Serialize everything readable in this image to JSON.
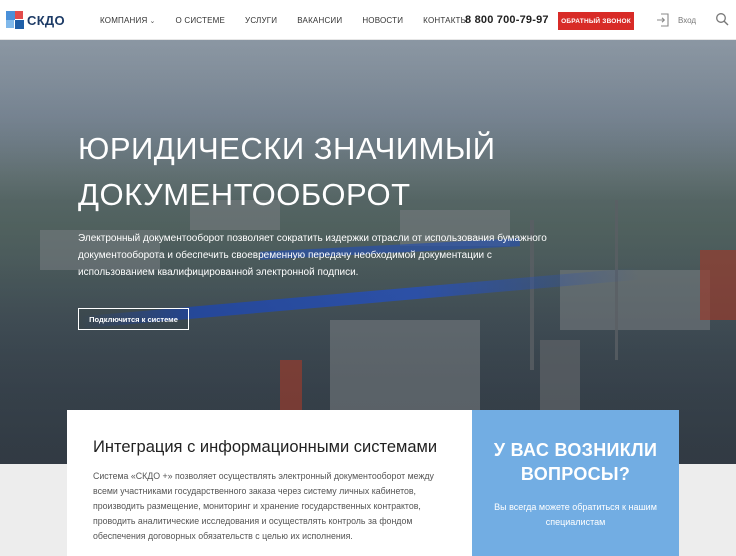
{
  "brand": {
    "name": "СКДО",
    "colors": {
      "blue": "#4a90d9",
      "red": "#e24b4b",
      "dark": "#1d3b66"
    }
  },
  "nav": {
    "items": [
      {
        "label": "КОМПАНИЯ",
        "has_dropdown": true
      },
      {
        "label": "О СИСТЕМЕ"
      },
      {
        "label": "УСЛУГИ"
      },
      {
        "label": "ВАКАНСИИ"
      },
      {
        "label": "НОВОСТИ"
      },
      {
        "label": "КОНТАКТЫ"
      }
    ]
  },
  "header": {
    "phone": "8 800 700-79-97",
    "callback_label": "ОБРАТНЫЙ ЗВОНОК",
    "login_label": "Вход",
    "accent_color": "#d82b27"
  },
  "hero": {
    "title_line1": "ЮРИДИЧЕСКИ ЗНАЧИМЫЙ",
    "title_line2": "ДОКУМЕНТООБОРОТ",
    "description": "Электронный документооборот позволяет сократить издержки отрасли от использования бумажного документооборота и обеспечить своевременную передачу необходимой документации с использованием квалифицированной электронной подписи.",
    "button_label": "Подключится к системе"
  },
  "info": {
    "title": "Интеграция с информационными системами",
    "text": "Система «СКДО +» позволяет осуществлять электронный документооборот между всеми участниками государственного заказа через систему личных кабинетов, производить размещение, мониторинг и хранение государственных контрактов, проводить аналитические исследования и осуществлять контроль за фондом обеспечения договорных обязательств с целью их исполнения."
  },
  "questions": {
    "title": "У ВАС ВОЗНИКЛИ ВОПРОСЫ?",
    "text": "Вы всегда можете обратиться к нашим специалистам",
    "color": "#72ade3"
  }
}
